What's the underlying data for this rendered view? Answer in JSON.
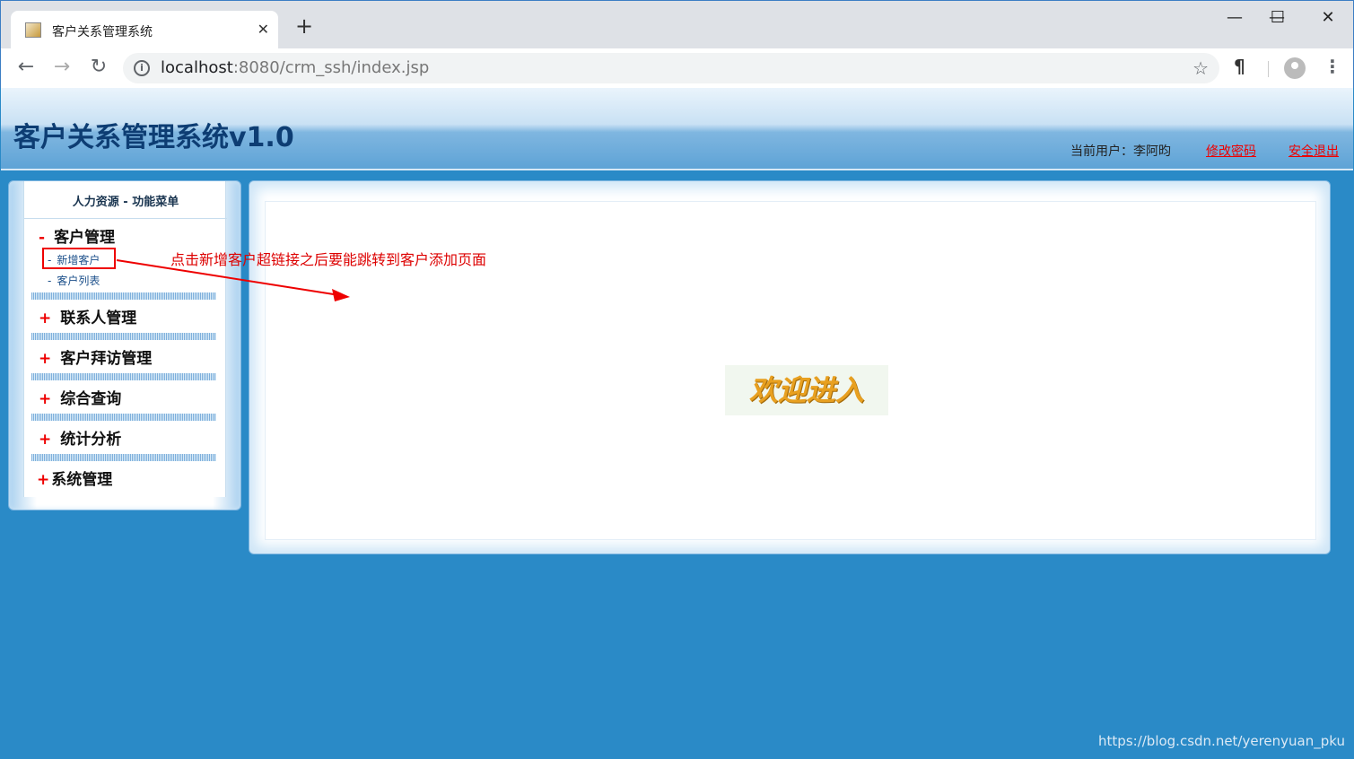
{
  "browser": {
    "tab_title": "客户关系管理系统",
    "tab_close": "✕",
    "new_tab": "+",
    "url_host": "localhost",
    "url_rest": ":8080/crm_ssh/index.jsp",
    "back": "←",
    "forward": "→",
    "reload": "↻",
    "star": "☆",
    "ext_glyph": "¶",
    "menu_glyph": "⋮",
    "min": "—",
    "max": "☐",
    "close": "✕"
  },
  "header": {
    "title": "客户关系管理系统v1.0",
    "current_user_label": "当前用户：李阿昀",
    "change_password": "修改密码",
    "logout": "安全退出"
  },
  "left_menu": {
    "heading": "人力资源 - 功能菜单",
    "groups": [
      {
        "symbol": "-",
        "label": "客户管理",
        "items": [
          "新增客户",
          "客户列表"
        ]
      },
      {
        "symbol": "+",
        "label": "联系人管理"
      },
      {
        "symbol": "+",
        "label": "客户拜访管理"
      },
      {
        "symbol": "+",
        "label": "综合查询"
      },
      {
        "symbol": "+",
        "label": "统计分析"
      },
      {
        "symbol": "+",
        "label": "系统管理"
      }
    ]
  },
  "main": {
    "welcome_text": "欢迎进入"
  },
  "annotation": "点击新增客户超链接之后要能跳转到客户添加页面",
  "watermark": "https://blog.csdn.net/yerenyuan_pku",
  "colors": {
    "page_bg": "#2a8ac7",
    "title_text": "#0d3d73",
    "link_red": "#e00000",
    "annotation_red": "#d00000"
  }
}
